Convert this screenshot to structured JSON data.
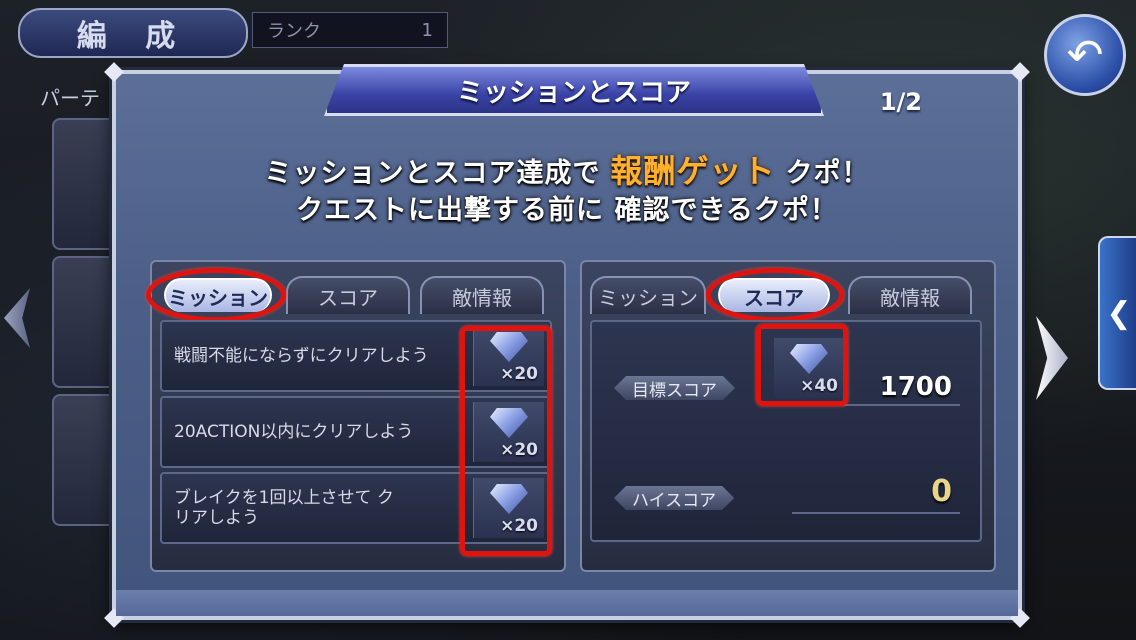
{
  "background": {
    "screen_title": "編 成",
    "rank_label": "ランク",
    "rank_value": "1",
    "party_label": "パーテ",
    "back_icon": "undo-arrow-icon",
    "side_tab_icon": "chevron-left-icon"
  },
  "dialog": {
    "title": "ミッションとスコア",
    "page": "1/2",
    "headline_line1_prefix": "ミッションとスコア達成で",
    "headline_line1_highlight": "報酬ゲット",
    "headline_line1_suffix": "クポ！",
    "headline_line2": "クエストに出撃する前に 確認できるクポ！",
    "highlight_color": "#ffb12e"
  },
  "left_panel": {
    "tabs": [
      {
        "label": "ミッション",
        "active": true
      },
      {
        "label": "スコア",
        "active": false
      },
      {
        "label": "敵情報",
        "active": false
      }
    ],
    "missions": [
      {
        "text": "戦闘不能にならずにクリアしよう",
        "reward_icon": "crystal-gem-icon",
        "reward": "×20"
      },
      {
        "text": "20ACTION以内にクリアしよう",
        "reward_icon": "crystal-gem-icon",
        "reward": "×20"
      },
      {
        "text": "ブレイクを1回以上させて クリアしよう",
        "reward_icon": "crystal-gem-icon",
        "reward": "×20"
      }
    ]
  },
  "right_panel": {
    "tabs": [
      {
        "label": "ミッション",
        "active": false
      },
      {
        "label": "スコア",
        "active": true
      },
      {
        "label": "敵情報",
        "active": false
      }
    ],
    "target_score_label": "目標スコア",
    "target_score_value": "1700",
    "target_reward_icon": "crystal-gem-icon",
    "target_reward": "×40",
    "high_score_label": "ハイスコア",
    "high_score_value": "0"
  },
  "annotation_color": "#e0140f"
}
